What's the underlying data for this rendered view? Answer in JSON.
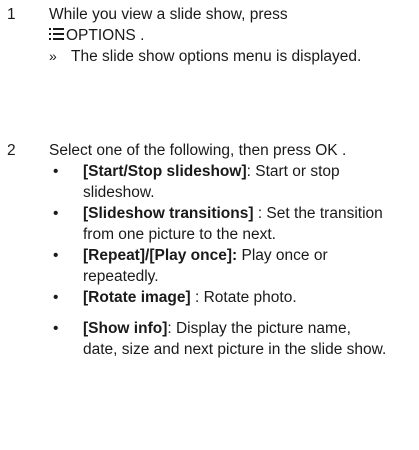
{
  "step1": {
    "number": "1",
    "text_line1": "While you view a slide show, press",
    "options_label": "OPTIONS .",
    "result_marker": "»",
    "result": "The slide show options menu is displayed."
  },
  "step2": {
    "number": "2",
    "text": "Select one of the following, then press OK .",
    "bullet": "•",
    "items": [
      {
        "term": "[Start/Stop slideshow]",
        "desc": ": Start or stop slideshow."
      },
      {
        "term": "[Slideshow transitions]",
        "desc": " : Set the transition from one picture to the next."
      },
      {
        "term": "[Repeat]/[Play once]:",
        "desc": " Play once or repeatedly."
      },
      {
        "term": "[Rotate image]",
        "desc": " : Rotate photo."
      },
      {
        "term": "[Show info]",
        "desc": ": Display the picture name, date, size and next picture in the slide show."
      }
    ]
  },
  "icons": {
    "options": "menu-lines-icon"
  }
}
